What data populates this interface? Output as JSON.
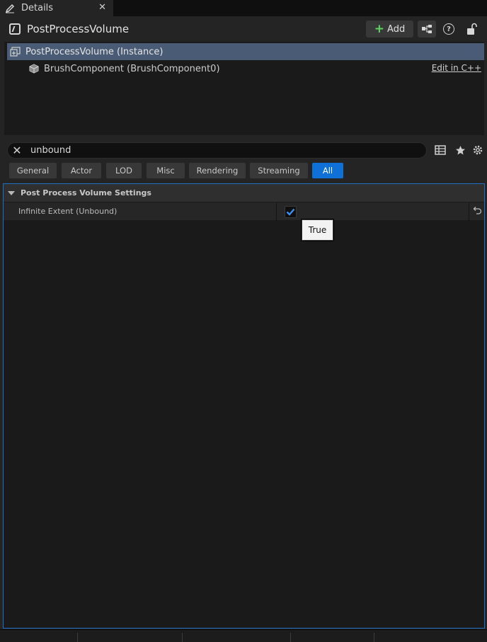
{
  "tab": {
    "title": "Details",
    "close": "✕"
  },
  "header": {
    "actor_name": "PostProcessVolume",
    "add_label": "Add"
  },
  "tree": {
    "items": [
      {
        "label": "PostProcessVolume (Instance)"
      },
      {
        "label": "BrushComponent (BrushComponent0)"
      }
    ],
    "edit_link": "Edit in C++"
  },
  "search": {
    "value": "unbound"
  },
  "filters": [
    "General",
    "Actor",
    "LOD",
    "Misc",
    "Rendering",
    "Streaming",
    "All"
  ],
  "details": {
    "category": "Post Process Volume Settings",
    "property_name": "Infinite Extent (Unbound)",
    "checked": true,
    "tooltip": "True"
  },
  "colors": {
    "accent": "#0f70d8",
    "selection": "#4a5c75",
    "add_plus": "#5fd35f"
  }
}
